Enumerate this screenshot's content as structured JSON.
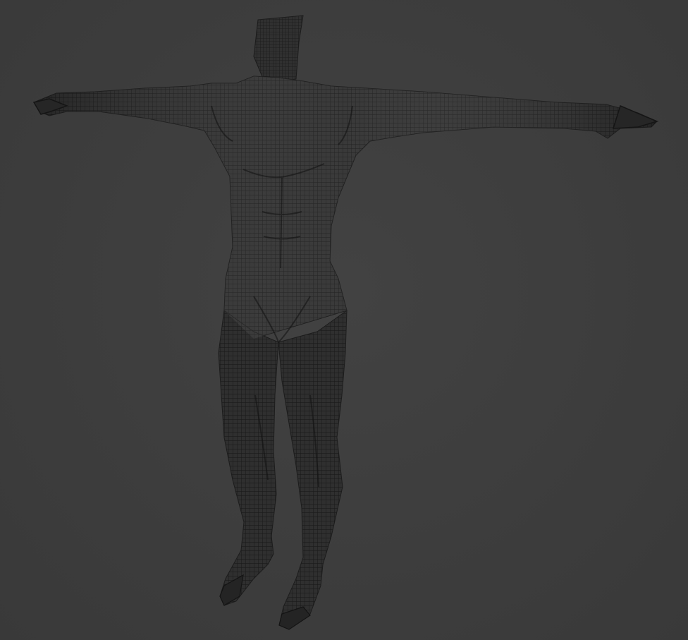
{
  "viewport": {
    "background_color": "#3d3d3d",
    "mesh_fill_color": "#2e2e2e",
    "wire_color": "#1a1a1a",
    "shading_mode": "wireframe-over-solid",
    "object": "humanoid-base-mesh",
    "pose": "t-pose"
  }
}
